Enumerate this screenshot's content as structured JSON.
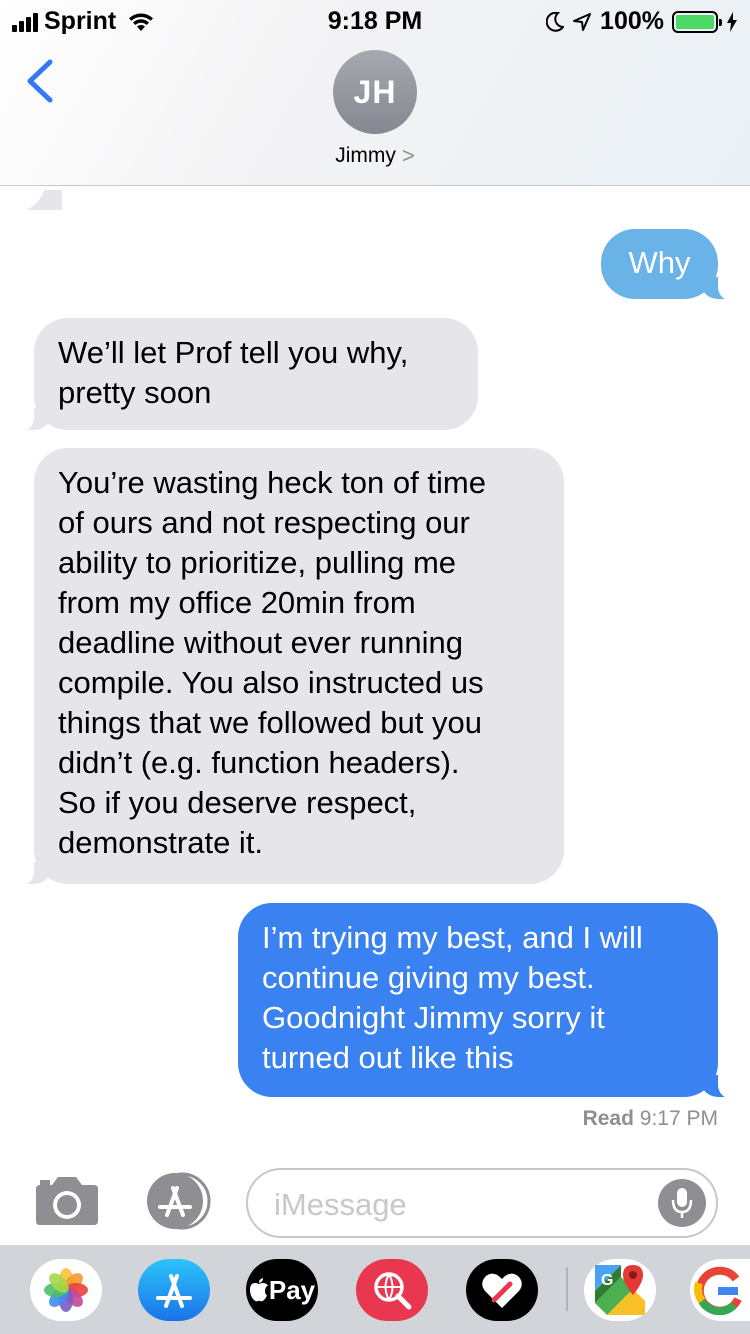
{
  "status_bar": {
    "carrier": "Sprint",
    "time": "9:18 PM",
    "battery_percent": "100%",
    "battery_level": 1.0
  },
  "contact": {
    "initials": "JH",
    "name": "Jimmy",
    "chevron": ">"
  },
  "messages": [
    {
      "direction": "sent",
      "text": "Why"
    },
    {
      "direction": "received",
      "lines": [
        "We’ll let Prof tell you why,",
        "pretty soon"
      ]
    },
    {
      "direction": "received",
      "lines": [
        "You’re wasting heck ton of time",
        "of ours and not respecting our",
        "ability to prioritize, pulling me",
        "from my office 20min from",
        "deadline without ever running",
        "compile. You also instructed us",
        "things that we followed but you",
        "didn’t (e.g. function headers).",
        "So if you deserve respect,",
        "demonstrate it."
      ]
    },
    {
      "direction": "sent",
      "lines": [
        "I’m trying my best, and I will",
        "continue giving my best.",
        "Goodnight Jimmy sorry it",
        "turned out like this"
      ]
    }
  ],
  "receipt": {
    "label": "Read",
    "time": "9:17 PM"
  },
  "compose": {
    "placeholder": "iMessage"
  },
  "colors": {
    "received_bubble": "#e5e5ea",
    "sent_sms_bubble": "#6ab3e8",
    "sent_imessage_bubble": "#3a82f1",
    "back_chevron": "#3478f6"
  },
  "drawer": {
    "apple_pay_label": "Pay"
  }
}
